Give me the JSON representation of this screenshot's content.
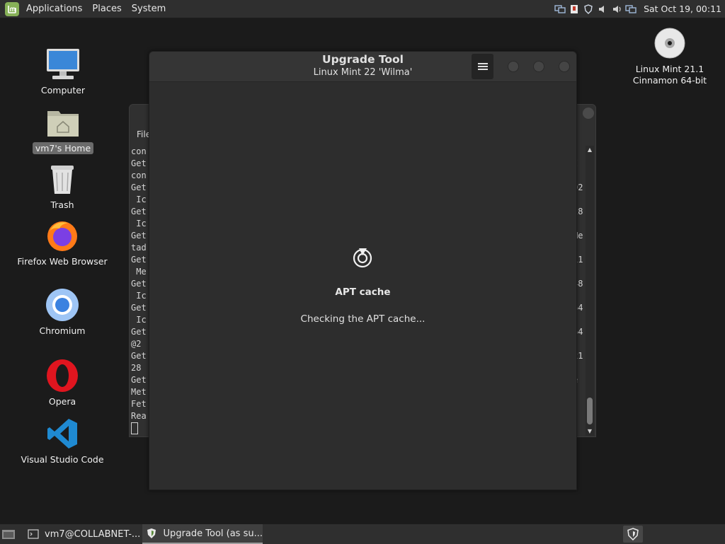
{
  "top_panel": {
    "menus": [
      "Applications",
      "Places",
      "System"
    ],
    "clock": "Sat Oct 19, 00:11"
  },
  "desktop": {
    "icons": [
      {
        "label": "Computer",
        "icon": "computer-icon"
      },
      {
        "label": "vm7's Home",
        "icon": "home-folder-icon",
        "selected": true
      },
      {
        "label": "Trash",
        "icon": "trash-icon"
      },
      {
        "label": "Firefox Web Browser",
        "icon": "firefox-icon"
      },
      {
        "label": "Chromium",
        "icon": "chromium-icon"
      },
      {
        "label": "Opera",
        "icon": "opera-icon"
      },
      {
        "label": "Visual Studio Code",
        "icon": "vscode-icon"
      }
    ],
    "right_icon": {
      "label_line1": "Linux Mint 21.1",
      "label_line2": "Cinnamon 64-bit",
      "icon": "disc-icon"
    }
  },
  "terminal": {
    "menu_label": "File",
    "lines": [
      "con",
      "Get",
      "con",
      "Get",
      " Ic",
      "Get",
      " Ic",
      "Get",
      "tad",
      "Get",
      " Me",
      "Get",
      " Ic",
      "Get",
      " Ic",
      "Get",
      "@2",
      "Get",
      "28",
      "Get",
      "Met",
      "Fet",
      "Rea"
    ],
    "right_fragments": [
      "",
      "I",
      "",
      "02",
      "",
      "28",
      "",
      "Me",
      "",
      "11",
      "",
      "48",
      "",
      "64",
      "",
      "64",
      "",
      "x1",
      "",
      "e",
      "",
      "",
      ""
    ]
  },
  "dialog": {
    "title": "Upgrade Tool",
    "subtitle": "Linux Mint 22 'Wilma'",
    "status_title": "APT cache",
    "status_text": "Checking the APT cache..."
  },
  "taskbar": {
    "items": [
      {
        "label": "vm7@COLLABNET-...",
        "icon": "terminal-icon",
        "active": false
      },
      {
        "label": "Upgrade Tool (as su...",
        "icon": "shield-icon",
        "active": true
      }
    ]
  }
}
